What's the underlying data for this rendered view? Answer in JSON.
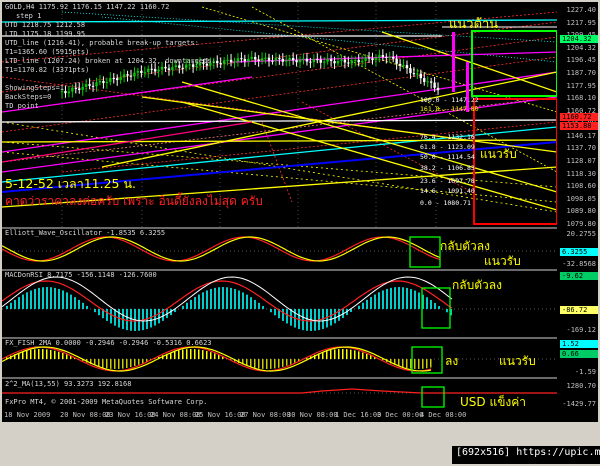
{
  "header": {
    "symbol_line": "GOLD,H4  1175.92 1176.15 1147.22 1160.72",
    "step_line": "step 1",
    "utd1_line": "UTD 1218.75  1212.58",
    "ltd1_line": "LTD 1175.18  1199.95",
    "utd_line_line": "UTD_line (1216.41), probable break-up targets:",
    "t1_line": "T1=1365.60 (5915pts)",
    "ltd_line_line": "LTD_line (1207.24) broken at 1204.32, downtargets:",
    "t1b_line": "T1=1170.82 (3371pts)",
    "showing_steps": "ShowingSteps=1",
    "back_steps": "BackSteps=0",
    "td_point": "TD point"
  },
  "annotations": {
    "date_note_line1": "5-12-52 เวลา11.25 น.",
    "date_note_line2": "คาดว่าราคาลงต่อครับ เพราะ อินดี้ยังลงไม่สุด ครับ",
    "resistance_label": "แนวต้าน",
    "support_label": "แนวรับ",
    "turn_down_1": "กลับตัวลง",
    "support_2": "แนวรับ",
    "turn_down_2": "กลับตัวลง",
    "down_label": "ลง",
    "support_3": "แนวรับ",
    "usd_strong": "USD แข็งค่า"
  },
  "fib_levels": [
    {
      "label": "100.0 - 1147.22",
      "color": "#ffffff"
    },
    {
      "label": "161.8 - 1147.80",
      "color": "#ffff00"
    },
    {
      "label": "76.4 - 1132.16",
      "color": "#ffffff"
    },
    {
      "label": "61.8 - 1123.09",
      "color": "#ffffff"
    },
    {
      "label": "50.0 - 1114.54",
      "color": "#ffffff"
    },
    {
      "label": "38.2 - 1106.83",
      "color": "#ffffff"
    },
    {
      "label": "23.6 - 1097.78",
      "color": "#ffffff"
    },
    {
      "label": "14.6 - 1091.40",
      "color": "#ffffff"
    },
    {
      "label": "0.0 - 1080.71",
      "color": "#ffffff"
    }
  ],
  "indicators": {
    "elliott": "Elliott_Wave_Oscillator -1.8535 6.3255",
    "macd": "MACDonRSI 8.7175 -156.1148 -126.7600",
    "fish": "FX_FISH_2MA 0.0000 -0.2946 -0.2946 -0.5316 0.6623",
    "ma": "2^2_MA(13,55) 93.3273 192.8168",
    "copyright": "FxPro MT4, © 2001-2009 MetaQuotes Software Corp."
  },
  "price_axis": {
    "labels": [
      "1227.40",
      "1217.95",
      "1209.45",
      "1204.32",
      "1196.45",
      "1187.70",
      "1177.95",
      "1168.10",
      "1160.72",
      "1153.89",
      "1146.17",
      "1137.70",
      "1128.07",
      "1118.30",
      "1108.60",
      "1098.05",
      "1089.80",
      "1079.80"
    ],
    "highlighted": [
      {
        "label": "1204.32",
        "bg": "#00ff66"
      },
      {
        "label": "1160.72",
        "bg": "#ff2020"
      },
      {
        "label": "1153.88",
        "bg": "#ff2020"
      }
    ],
    "elliott_top": "20.2755",
    "elliott_mid": "6.3255",
    "elliott_bot": "-32.8568",
    "macd_top": "-9.62",
    "macd_zero": "-86.72",
    "macd_bot": "-169.12",
    "fish_top": "1.52",
    "fish_mid": "0.66",
    "fish_bot": "-1.59",
    "ma_top": "1280.70",
    "ma_bot": "-1429.77"
  },
  "dates": [
    "18 Nov 2009",
    "20 Nov 08:00",
    "23 Nov 16:00",
    "24 Nov 08:00",
    "25 Nov 16:00",
    "27 Nov 08:00",
    "30 Nov 08:00",
    "1 Dec 16:00",
    "3 Dec 00:00",
    "4 Dec 08:00"
  ],
  "watermark": "[692x516] https://upic.me/",
  "colors": {
    "background": "#000000",
    "resistance_box": "#00ff00",
    "support_box": "#ff0000",
    "bull_candle": "#00cc00",
    "bear_candle": "#ffffff",
    "magenta": "#ff00ff"
  }
}
